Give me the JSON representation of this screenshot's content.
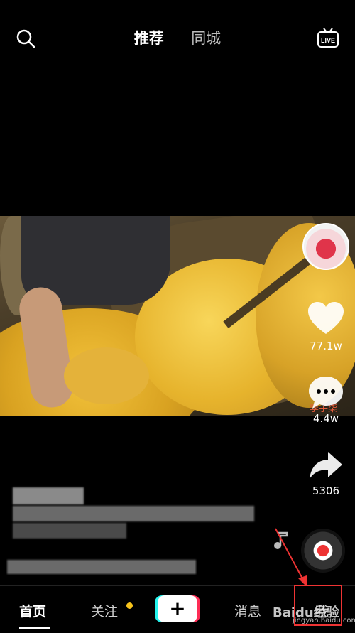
{
  "top_bar": {
    "tabs": [
      {
        "label": "推荐",
        "active": true
      },
      {
        "label": "同城",
        "active": false
      }
    ],
    "icons": [
      "search-icon",
      "live-icon"
    ],
    "live_label": "LIVE"
  },
  "video": {
    "watermark": "李子柒"
  },
  "right_rail": {
    "likes": "77.1w",
    "comments": "4.4w",
    "shares": "5306"
  },
  "bottom_nav": {
    "home": "首页",
    "follow": "关注",
    "plus": "+",
    "messages": "消息",
    "me": "我"
  },
  "overlay": {
    "baidu_logo": "Baidu经验",
    "baidu_url": "jingyan.baidu.com",
    "highlight_color": "#e33333"
  }
}
